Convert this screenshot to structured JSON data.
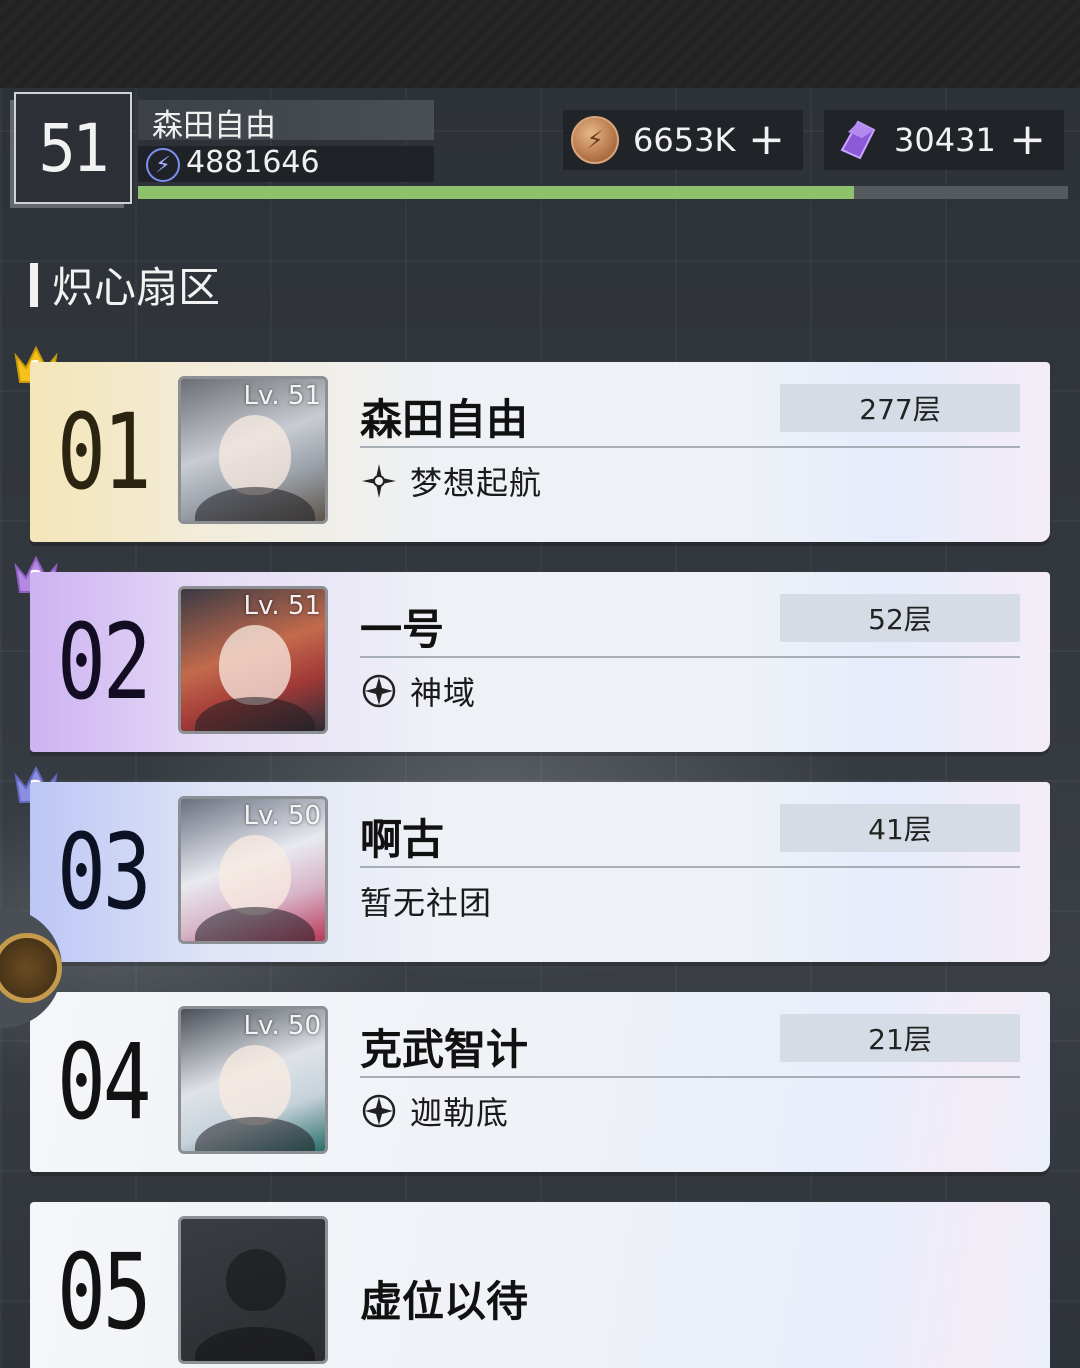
{
  "header": {
    "level": "51",
    "player_name": "森田自由",
    "power": "4881646",
    "exp_progress": 0.77,
    "gold": {
      "value": "6653K",
      "icon": "coin-icon"
    },
    "gems": {
      "value": "30431",
      "icon": "gem-icon"
    },
    "plus_label": "+"
  },
  "section": {
    "title": "炽心扇区"
  },
  "rankings": [
    {
      "rank": "01",
      "level": "Lv. 51",
      "name": "森田自由",
      "floor": "277层",
      "guild": "梦想起航",
      "guild_icon": "compass-star-icon",
      "crown": "1"
    },
    {
      "rank": "02",
      "level": "Lv. 51",
      "name": "一号",
      "floor": "52层",
      "guild": "神域",
      "guild_icon": "compass-icon",
      "crown": "2"
    },
    {
      "rank": "03",
      "level": "Lv. 50",
      "name": "啊古",
      "floor": "41层",
      "guild": "暂无社团",
      "guild_icon": "",
      "crown": "3"
    },
    {
      "rank": "04",
      "level": "Lv. 50",
      "name": "克武智计",
      "floor": "21层",
      "guild": "迦勒底",
      "guild_icon": "compass-icon",
      "crown": ""
    },
    {
      "rank": "05",
      "level": "",
      "name": "虚位以待",
      "floor": "",
      "guild": "",
      "guild_icon": "",
      "crown": ""
    }
  ],
  "colors": {
    "exp_bar": "#8dc26a",
    "gold_crown": "#f4c21a",
    "purple_crown": "#b48ae0",
    "blue_crown": "#8b8fe0"
  }
}
